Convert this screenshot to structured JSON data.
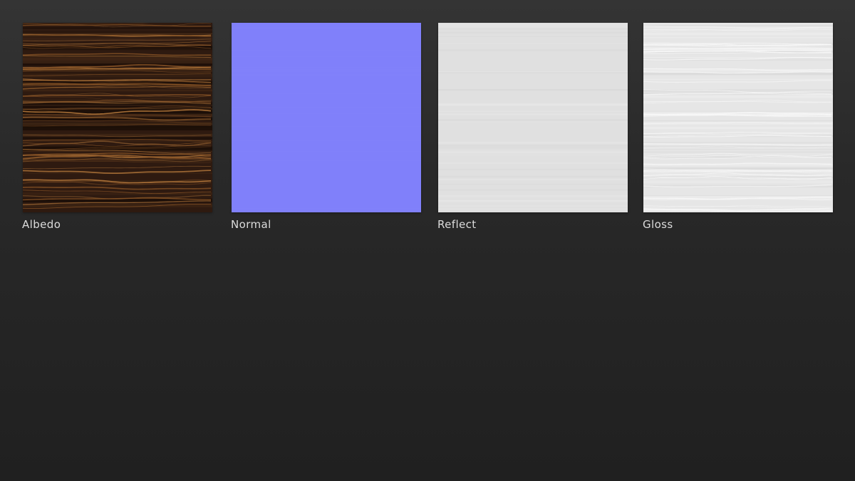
{
  "texture_maps": [
    {
      "label": "Albedo",
      "texture": "dark-wood-grain",
      "base_color": "#2e1a10",
      "accent_color": "#8a5526"
    },
    {
      "label": "Normal",
      "texture": "flat-normal",
      "base_color": "#8080fa"
    },
    {
      "label": "Reflect",
      "texture": "smooth-light",
      "base_color": "#e0e0e0"
    },
    {
      "label": "Gloss",
      "texture": "light-grain",
      "base_color": "#e6e6e6",
      "accent_color": "#f8f8f8"
    }
  ]
}
